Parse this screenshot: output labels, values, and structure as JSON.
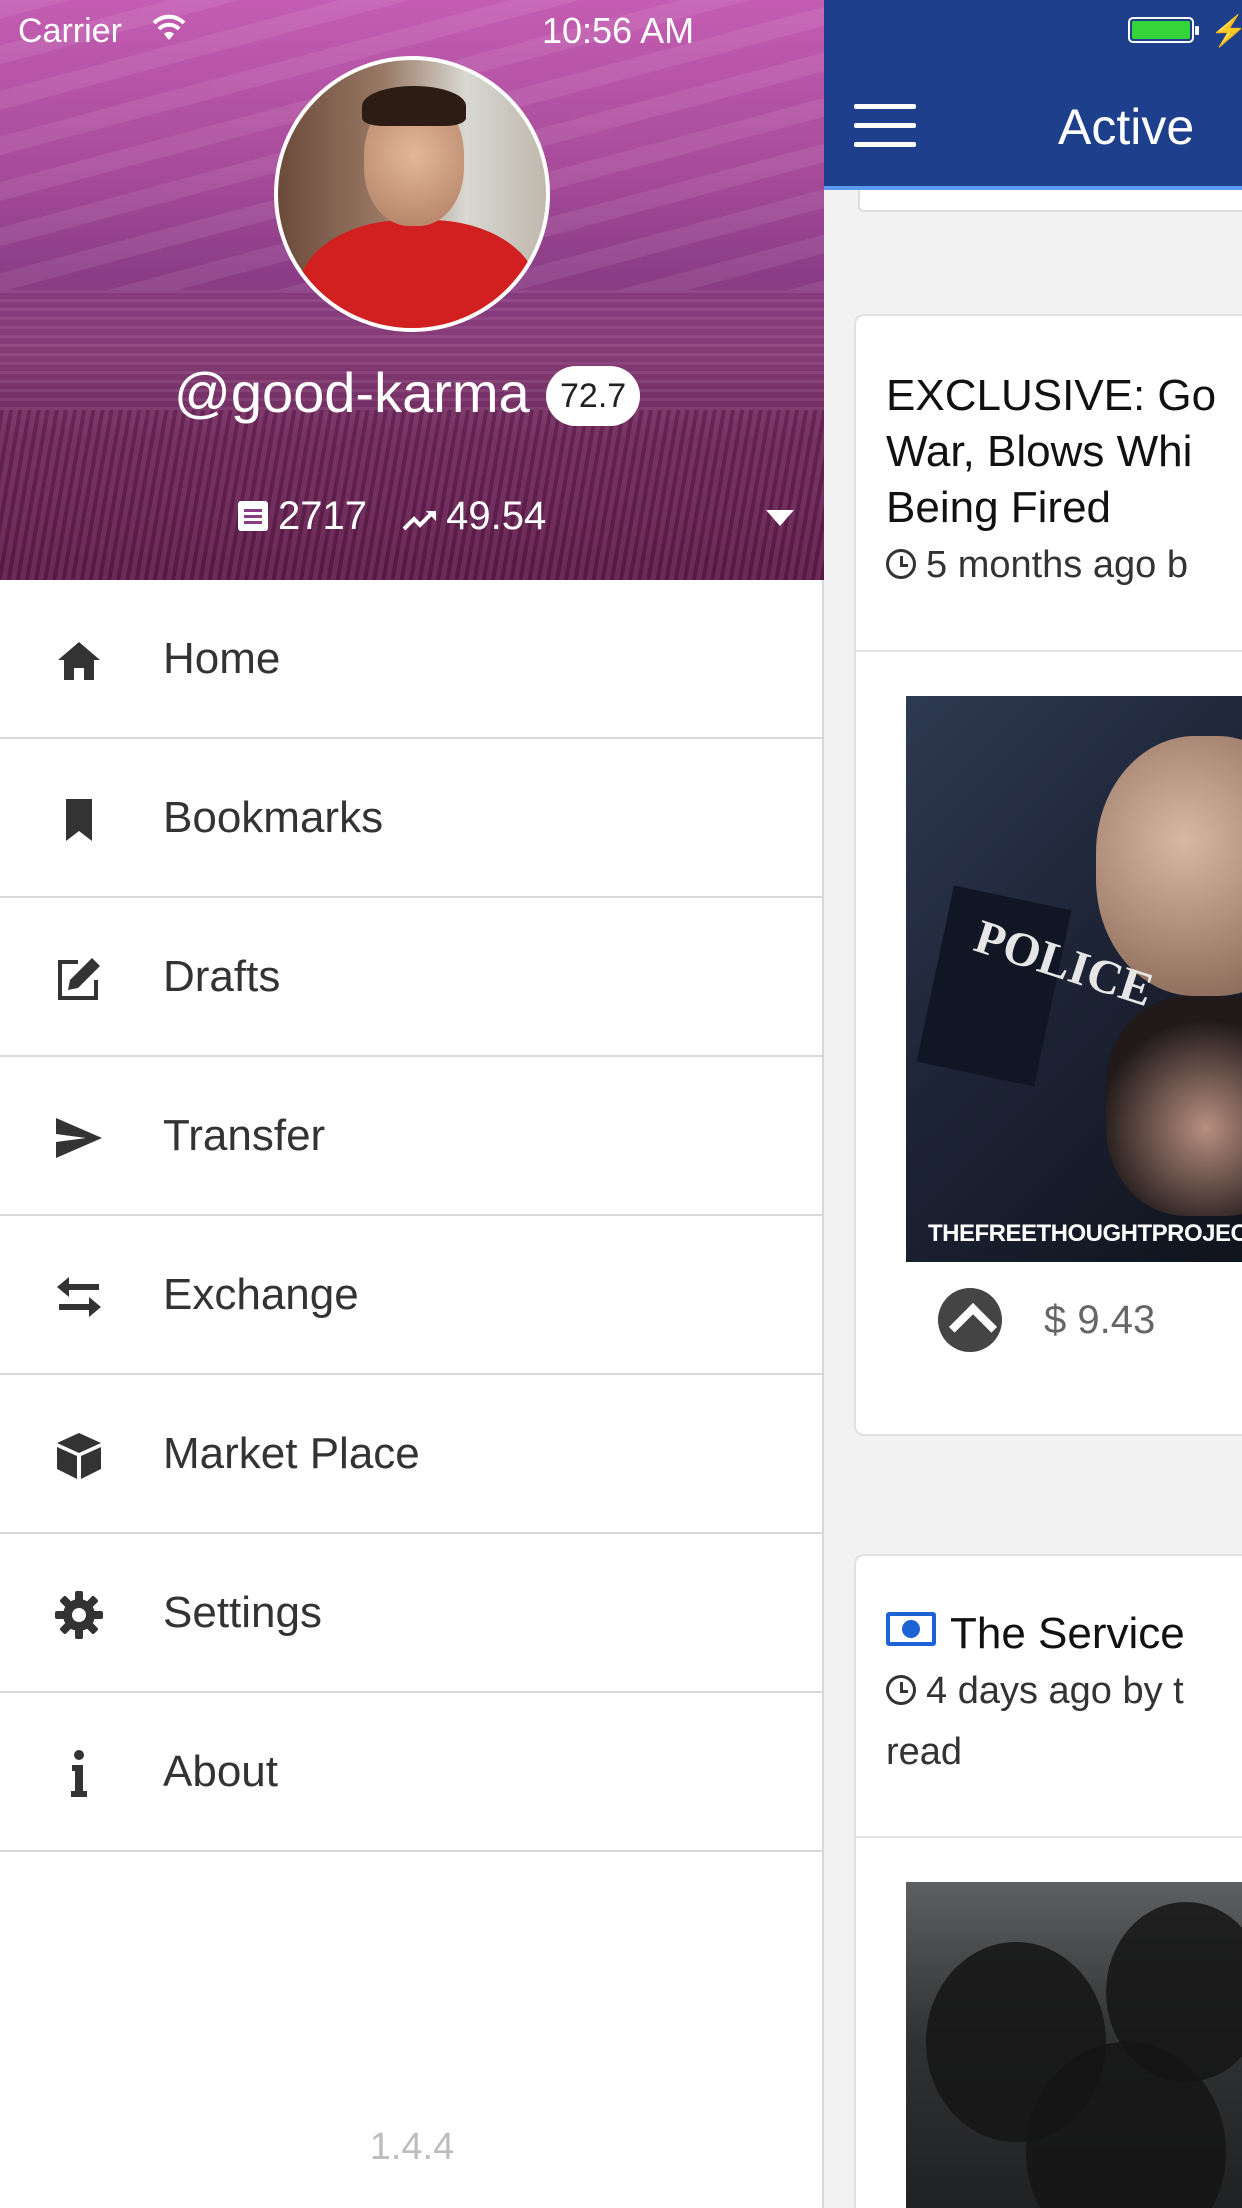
{
  "status_bar": {
    "carrier": "Carrier",
    "time": "10:56 AM"
  },
  "app_bar": {
    "title": "Active"
  },
  "profile": {
    "username": "@good-karma",
    "reputation": "72.7",
    "post_count": "2717",
    "voting_power": "49.54"
  },
  "menu": {
    "items": [
      {
        "label": "Home",
        "icon": "home-icon"
      },
      {
        "label": "Bookmarks",
        "icon": "bookmark-icon"
      },
      {
        "label": "Drafts",
        "icon": "edit-icon"
      },
      {
        "label": "Transfer",
        "icon": "send-icon"
      },
      {
        "label": "Exchange",
        "icon": "exchange-icon"
      },
      {
        "label": "Market Place",
        "icon": "cube-icon"
      },
      {
        "label": "Settings",
        "icon": "gear-icon"
      },
      {
        "label": "About",
        "icon": "info-icon"
      }
    ]
  },
  "version": "1.4.4",
  "feed": {
    "posts": [
      {
        "title_lines": [
          "EXCLUSIVE: Go",
          "War, Blows Whi",
          "Being Fired"
        ],
        "meta": "5 months ago  b",
        "image_caption": "THEFREETHOUGHTPROJECT",
        "image_text": "POLICE",
        "payout": "$ 9.43"
      },
      {
        "title": "The Service",
        "meta": "4 days ago  by t",
        "meta2": "read"
      }
    ]
  },
  "colors": {
    "app_bar": "#1d3f8c",
    "header_tint": "#8a3c85",
    "battery": "#35d43a",
    "accent_blue": "#1e63d6"
  }
}
